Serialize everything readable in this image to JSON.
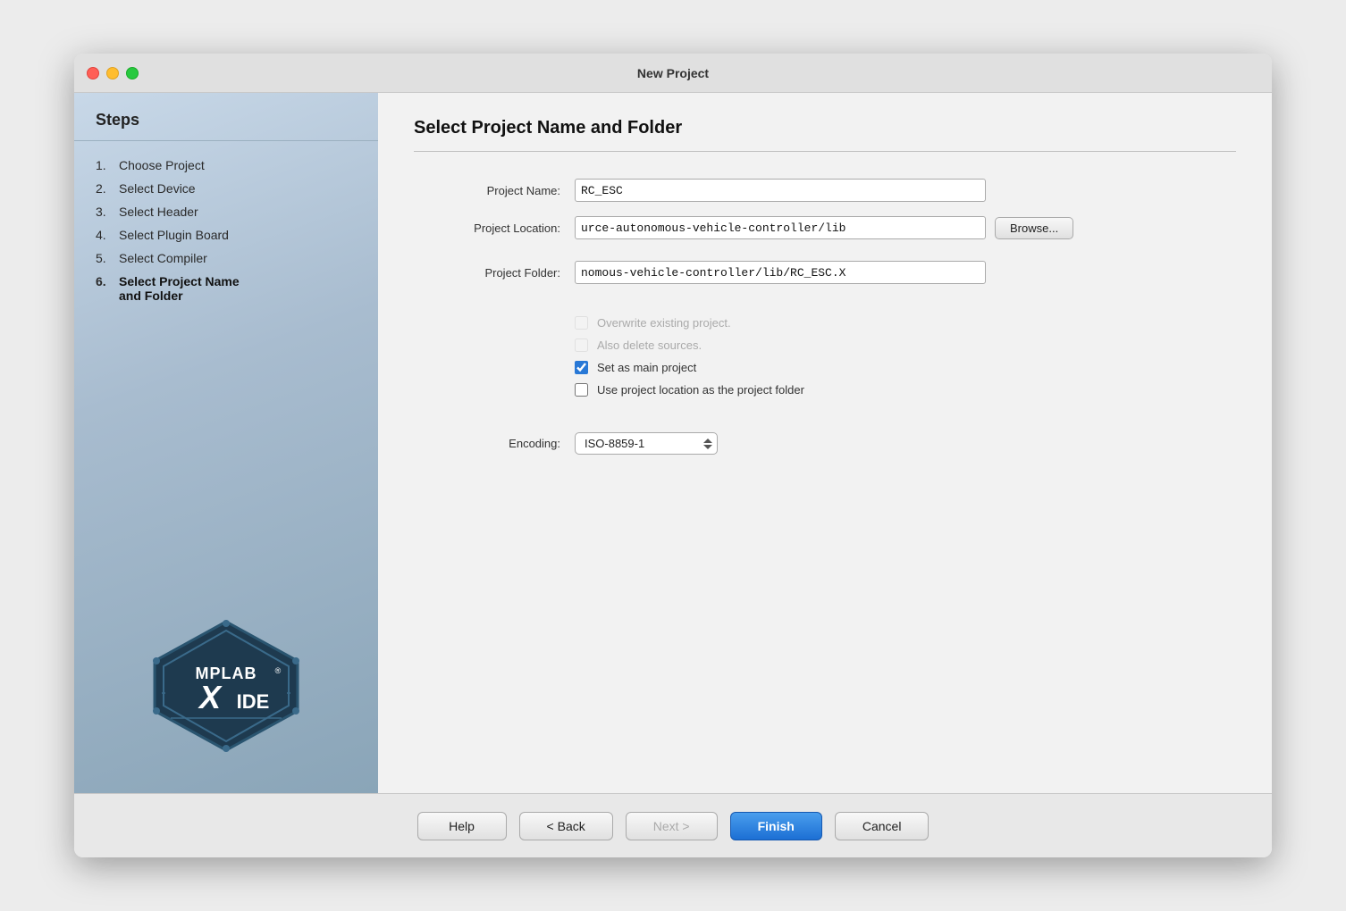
{
  "window": {
    "title": "New Project"
  },
  "sidebar": {
    "header": "Steps",
    "steps": [
      {
        "num": "1.",
        "label": "Choose Project",
        "active": false
      },
      {
        "num": "2.",
        "label": "Select Device",
        "active": false
      },
      {
        "num": "3.",
        "label": "Select Header",
        "active": false
      },
      {
        "num": "4.",
        "label": "Select Plugin Board",
        "active": false
      },
      {
        "num": "5.",
        "label": "Select Compiler",
        "active": false
      },
      {
        "num": "6.",
        "label": "Select Project Name and Folder",
        "active": true
      }
    ]
  },
  "panel": {
    "title": "Select Project Name and Folder",
    "project_name_label": "Project Name:",
    "project_name_value": "RC_ESC",
    "project_location_label": "Project Location:",
    "project_location_value": "urce-autonomous-vehicle-controller/lib",
    "project_folder_label": "Project Folder:",
    "project_folder_value": "nomous-vehicle-controller/lib/RC_ESC.X",
    "browse_label": "Browse...",
    "overwrite_label": "Overwrite existing project.",
    "delete_sources_label": "Also delete sources.",
    "set_main_label": "Set as main project",
    "use_location_label": "Use project location as the project folder",
    "encoding_label": "Encoding:",
    "encoding_value": "ISO-8859-1"
  },
  "buttons": {
    "help": "Help",
    "back": "< Back",
    "next": "Next >",
    "finish": "Finish",
    "cancel": "Cancel"
  }
}
